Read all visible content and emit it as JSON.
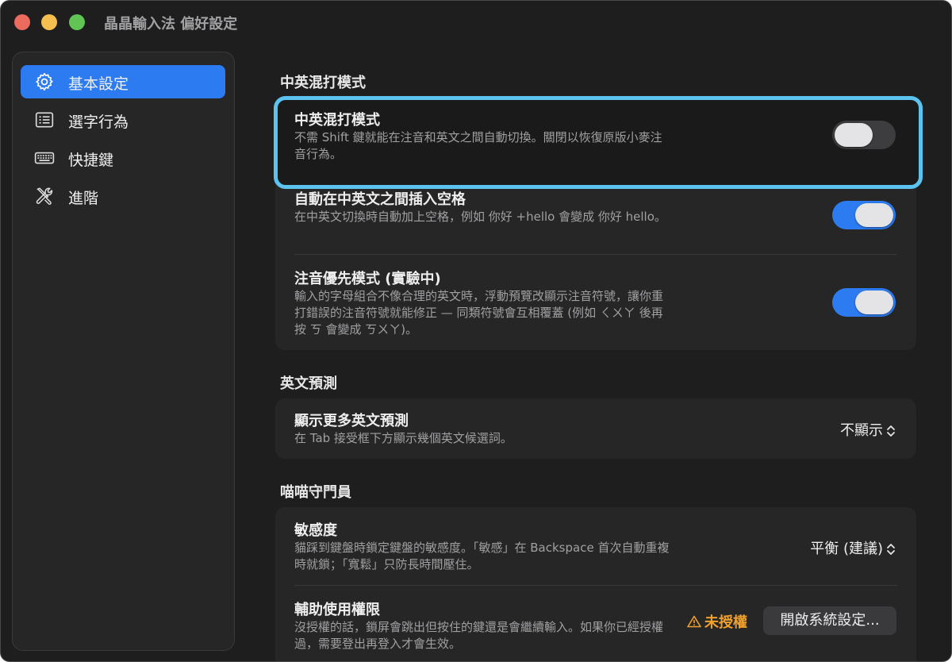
{
  "window": {
    "title": "晶晶輸入法 偏好設定"
  },
  "sidebar": {
    "items": [
      {
        "label": "基本設定",
        "icon": "gear-icon",
        "active": true
      },
      {
        "label": "選字行為",
        "icon": "list-icon",
        "active": false
      },
      {
        "label": "快捷鍵",
        "icon": "keyboard-icon",
        "active": false
      },
      {
        "label": "進階",
        "icon": "tools-icon",
        "active": false
      }
    ]
  },
  "sections": {
    "mixed": {
      "title": "中英混打模式",
      "rows": [
        {
          "title": "中英混打模式",
          "desc": "不需 Shift 鍵就能在注音和英文之間自動切換。關閉以恢復原版小麥注音行為。",
          "toggle": false
        },
        {
          "title": "自動在中英文之間插入空格",
          "desc": "在中英文切換時自動加上空格，例如 你好 +hello 會變成 你好 hello。",
          "toggle": true
        },
        {
          "title": "注音優先模式 (實驗中)",
          "desc": "輸入的字母組合不像合理的英文時，浮動預覽改顯示注音符號，讓你重打錯誤的注音符號就能修正 — 同類符號會互相覆蓋 (例如 ㄑㄨㄚ 後再按 ㄎ 會變成 ㄎㄨㄚ)。",
          "toggle": true
        }
      ]
    },
    "english": {
      "title": "英文預測",
      "rows": [
        {
          "title": "顯示更多英文預測",
          "desc": "在 Tab 接受框下方顯示幾個英文候選詞。",
          "value": "不顯示"
        }
      ]
    },
    "gatekeeper": {
      "title": "喵喵守門員",
      "rows": [
        {
          "title": "敏感度",
          "desc": "貓踩到鍵盤時鎖定鍵盤的敏感度。「敏感」在 Backspace 首次自動重複時就鎖；「寬鬆」只防長時間壓住。",
          "value": "平衡 (建議)"
        },
        {
          "title": "輔助使用權限",
          "desc": "沒授權的話，鎖屏會跳出但按住的鍵還是會繼續輸入。如果你已經授權過，需要登出再登入才會生效。",
          "status": "未授權",
          "button": "開啟系統設定..."
        }
      ]
    }
  },
  "colors": {
    "accent": "#2d7bf0",
    "highlight": "#5cc3ef",
    "warning": "#f0a02c",
    "window_bg": "#1e1e1f",
    "card_bg": "#262627"
  }
}
